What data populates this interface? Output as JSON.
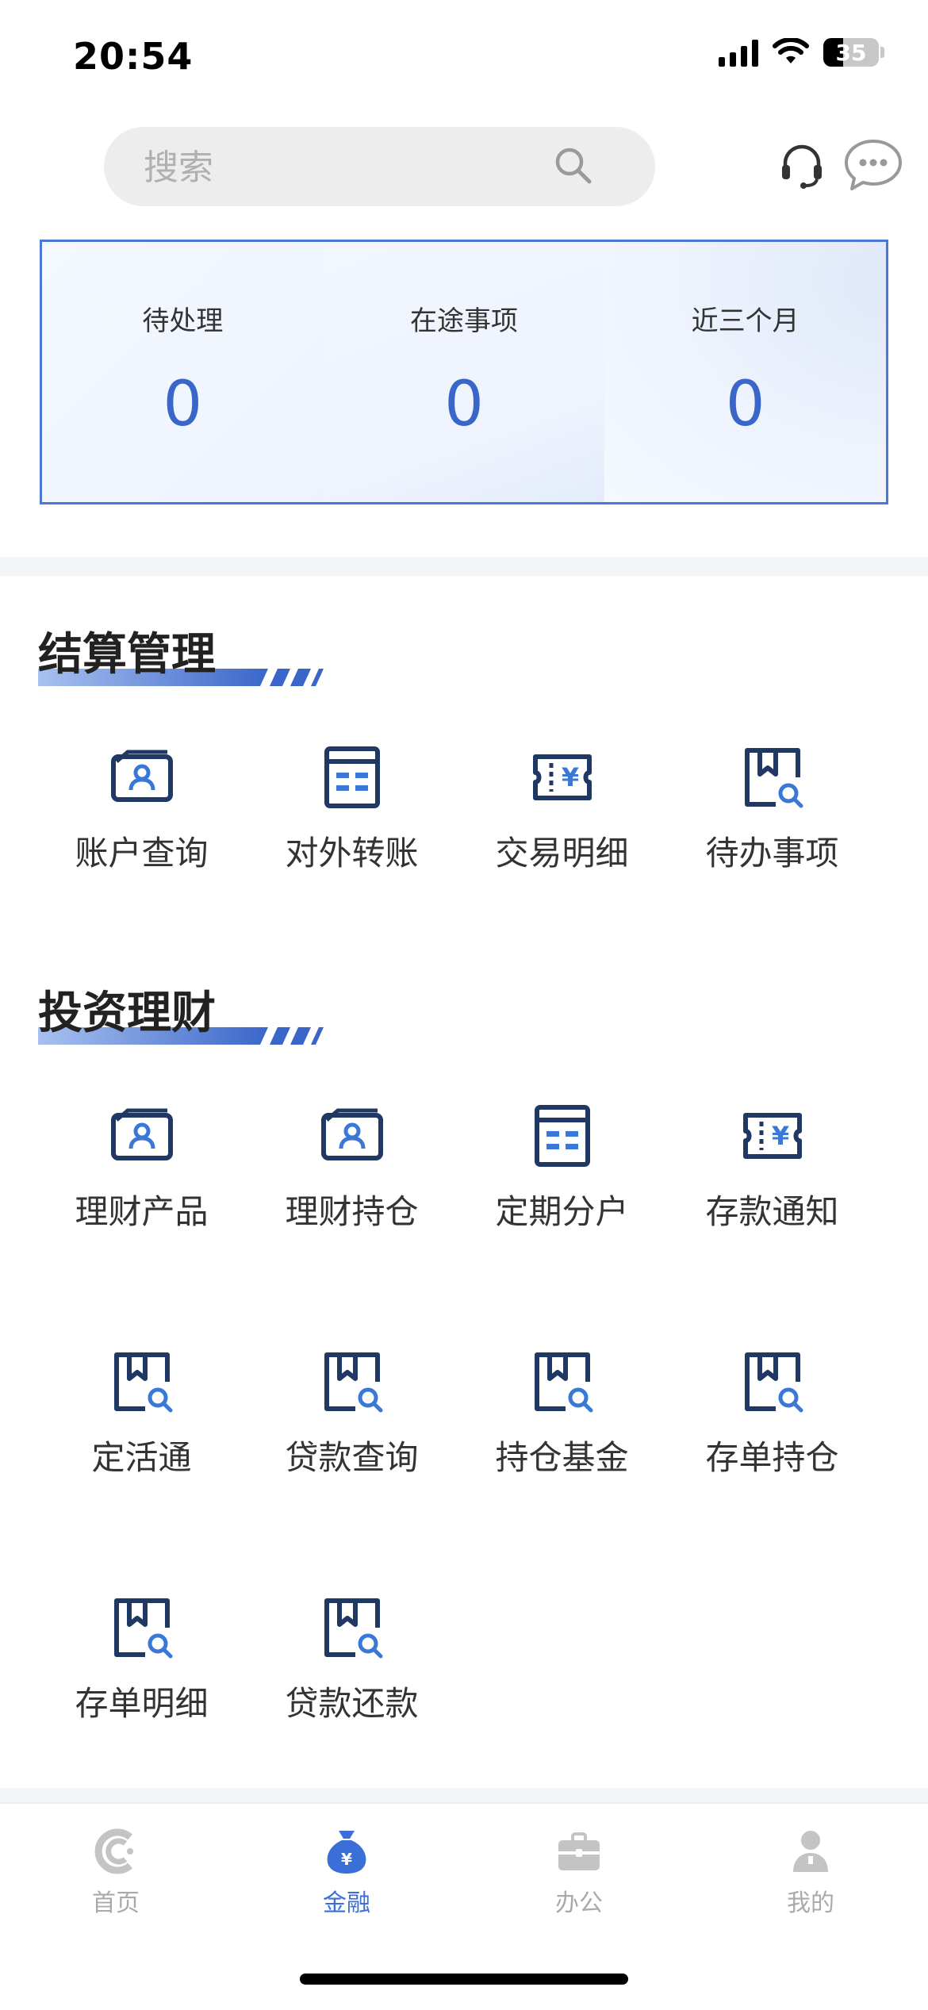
{
  "status_bar": {
    "time": "20:54",
    "battery": "35"
  },
  "search": {
    "placeholder": "搜索"
  },
  "stats": [
    {
      "label": "待处理",
      "value": "0"
    },
    {
      "label": "在途事项",
      "value": "0"
    },
    {
      "label": "近三个月",
      "value": "0"
    }
  ],
  "sections": [
    {
      "title": "结算管理",
      "items": [
        {
          "label": "账户查询",
          "icon": "account-card-icon"
        },
        {
          "label": "对外转账",
          "icon": "transfer-box-icon"
        },
        {
          "label": "交易明细",
          "icon": "yuan-ticket-icon"
        },
        {
          "label": "待办事项",
          "icon": "bookmark-search-icon"
        }
      ]
    },
    {
      "title": "投资理财",
      "items": [
        {
          "label": "理财产品",
          "icon": "account-card-icon"
        },
        {
          "label": "理财持仓",
          "icon": "account-card-icon"
        },
        {
          "label": "定期分户",
          "icon": "transfer-box-icon"
        },
        {
          "label": "存款通知",
          "icon": "yuan-ticket-icon"
        },
        {
          "label": "定活通",
          "icon": "bookmark-search-icon"
        },
        {
          "label": "贷款查询",
          "icon": "bookmark-search-icon"
        },
        {
          "label": "持仓基金",
          "icon": "bookmark-search-icon"
        },
        {
          "label": "存单持仓",
          "icon": "bookmark-search-icon"
        },
        {
          "label": "存单明细",
          "icon": "bookmark-search-icon"
        },
        {
          "label": "贷款还款",
          "icon": "bookmark-search-icon"
        }
      ]
    }
  ],
  "tabs": [
    {
      "label": "首页",
      "icon": "home-logo-icon",
      "active": false
    },
    {
      "label": "金融",
      "icon": "money-bag-icon",
      "active": true
    },
    {
      "label": "办公",
      "icon": "briefcase-icon",
      "active": false
    },
    {
      "label": "我的",
      "icon": "person-icon",
      "active": false
    }
  ],
  "colors": {
    "accent": "#3a66c9",
    "icon_dark": "#1f3864",
    "icon_light": "#3a78d8",
    "tab_active": "#3a6fd8",
    "tab_inactive": "#aaaaaa"
  }
}
